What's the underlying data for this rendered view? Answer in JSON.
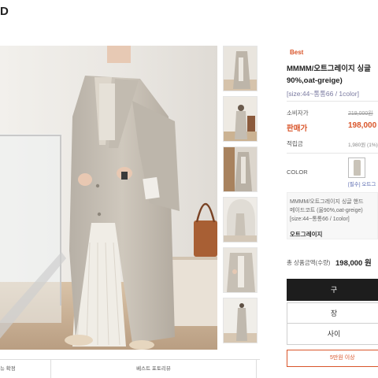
{
  "brand": {
    "logo_text": "D"
  },
  "product": {
    "badge": "Best",
    "name_line1": "MMMM/오트그레이지 싱글",
    "name_line2": "90%,oat-greige)",
    "size_text": "[size:44~통통66 / 1color]",
    "consumer_price_label": "소비자가",
    "consumer_price": "219,000원",
    "sale_price_label": "판매가",
    "sale_price": "198,000",
    "points_label": "적립금",
    "points_value": "1,980원 (1%)",
    "color_label": "COLOR",
    "color_swatch_caption": "[필수] 오트그",
    "selected_line1": "MMMM/오트그레이지 싱글 핸드",
    "selected_line2": "메이드코트 (울90%,oat-greige)",
    "selected_line3": "[size:44~통통66 / 1color]",
    "selected_option": "오트그레이지",
    "total_label": "총 상품금액(수량)",
    "total_price": "198,000 원"
  },
  "buttons": {
    "buy": "구",
    "cart": "장",
    "wish": "사이",
    "extra": "5만원 이상"
  },
  "bottom_tabs": {
    "left": "뉴 확정",
    "right": "베스트 포토리뷰"
  },
  "colors": {
    "accent": "#d9552a",
    "buy_button": "#1d1d1d",
    "swatch": "#c9c3b8"
  }
}
